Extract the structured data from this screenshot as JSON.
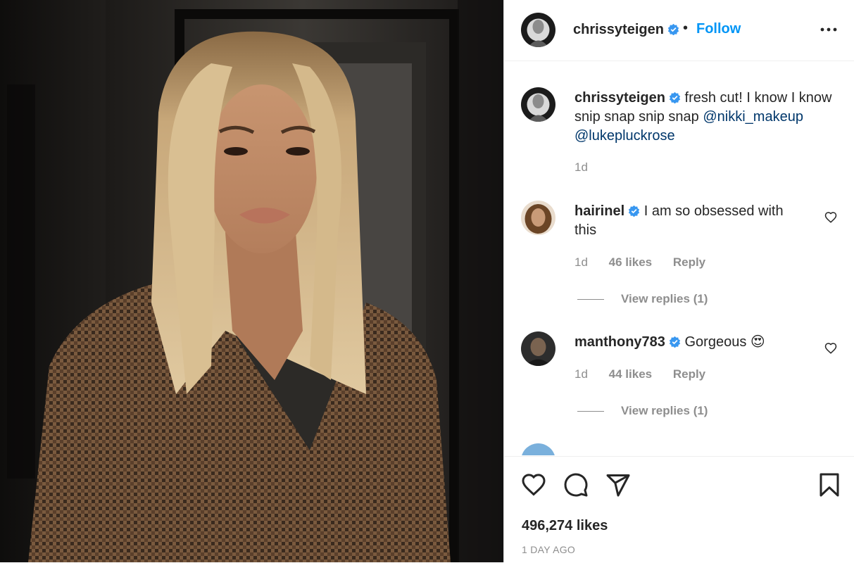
{
  "post": {
    "username": "chrissyteigen",
    "follow_label": "Follow",
    "separator": "•",
    "caption": {
      "text": "fresh cut! I know I know snip snap snip snap",
      "mentions": [
        "@nikki_makeup",
        "@lukepluckrose"
      ],
      "time": "1d"
    },
    "likes": "496,274 likes",
    "time_ago": "1 DAY AGO"
  },
  "comments": [
    {
      "username": "hairinel",
      "text": "I am so obsessed with this",
      "time": "1d",
      "likes": "46 likes",
      "reply_label": "Reply",
      "view_replies": "View replies (1)"
    },
    {
      "username": "manthony783",
      "text": "Gorgeous 😍",
      "time": "1d",
      "likes": "44 likes",
      "reply_label": "Reply",
      "view_replies": "View replies (1)"
    }
  ],
  "icons": {
    "more": "more-options-icon",
    "verified": "verified-badge-icon",
    "like": "heart-icon",
    "comment": "comment-icon",
    "share": "share-icon",
    "save": "bookmark-icon"
  },
  "colors": {
    "link": "#0095f6",
    "mention": "#00376b",
    "verified": "#3897f0",
    "muted": "#8e8e8e",
    "text": "#262626"
  }
}
